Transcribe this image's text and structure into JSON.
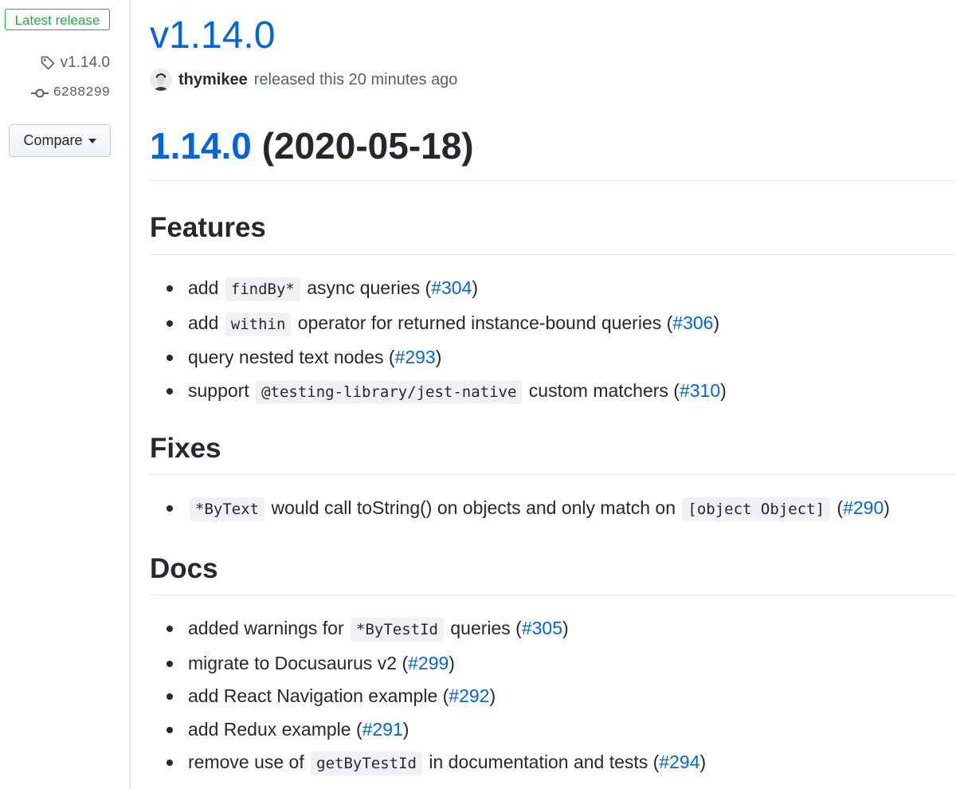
{
  "sidebar": {
    "badge": "Latest release",
    "tag": "v1.14.0",
    "commit": "6288299",
    "compare": "Compare"
  },
  "release": {
    "title": "v1.14.0",
    "author": "thymikee",
    "released_text": "released this 20 minutes ago"
  },
  "body": {
    "version_link": "1.14.0",
    "version_date": "(2020-05-18)",
    "sections": {
      "features": {
        "heading": "Features",
        "items": [
          {
            "pre": "add ",
            "code": "findBy*",
            "mid": " async queries (",
            "link": "#304",
            "post": ")"
          },
          {
            "pre": "add ",
            "code": "within",
            "mid": " operator for returned instance-bound queries (",
            "link": "#306",
            "post": ")"
          },
          {
            "pre": "query nested text nodes (",
            "link": "#293",
            "post": ")"
          },
          {
            "pre": "support ",
            "code": "@testing-library/jest-native",
            "mid": " custom matchers (",
            "link": "#310",
            "post": ")"
          }
        ]
      },
      "fixes": {
        "heading": "Fixes",
        "items": [
          {
            "code": "*ByText",
            "mid": " would call toString() on objects and only match on ",
            "code2": "[object Object]",
            "mid2": " (",
            "link": "#290",
            "post": ")"
          }
        ]
      },
      "docs": {
        "heading": "Docs",
        "items": [
          {
            "pre": "added warnings for ",
            "code": "*ByTestId",
            "mid": " queries (",
            "link": "#305",
            "post": ")"
          },
          {
            "pre": "migrate to Docusaurus v2 (",
            "link": "#299",
            "post": ")"
          },
          {
            "pre": "add React Navigation example (",
            "link": "#292",
            "post": ")"
          },
          {
            "pre": "add Redux example (",
            "link": "#291",
            "post": ")"
          },
          {
            "pre": "remove use of ",
            "code": "getByTestId",
            "mid": " in documentation and tests (",
            "link": "#294",
            "post": ")"
          }
        ]
      }
    }
  },
  "colors": {
    "link": "#0366d6",
    "badge_green": "#28a745",
    "text": "#24292e",
    "muted": "#586069"
  },
  "icons": {
    "tag": "tag-icon",
    "commit": "git-commit-icon",
    "caret": "caret-down-icon"
  }
}
